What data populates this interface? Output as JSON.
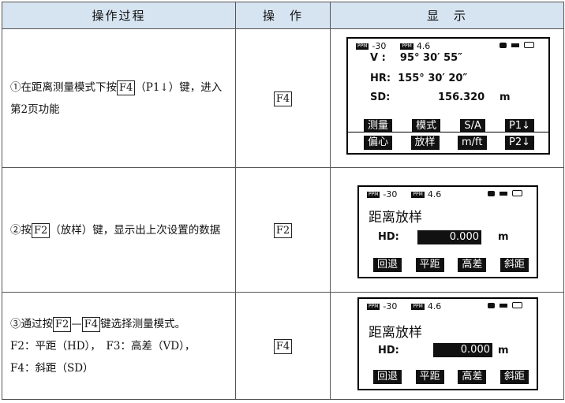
{
  "header": {
    "col1": "操作过程",
    "col2": "操　作",
    "col3": "显　示"
  },
  "rows": [
    {
      "desc_prefix": "①在距离测量模式下按",
      "desc_key": "F4",
      "desc_suffix": "（P1↓）键，进入第2页功能",
      "op_key": "F4",
      "screen": {
        "ppm_label": "PPM",
        "ppm_value": "-30",
        "prism_label": "PPM",
        "prism_value": "4.6",
        "lines": [
          {
            "label": "V  :",
            "value": "95° 30′ 55″",
            "unit": ""
          },
          {
            "label": "HR:",
            "value": "155° 30′ 20″",
            "unit": ""
          },
          {
            "label": "SD:",
            "value": "156.320",
            "unit": "m"
          }
        ],
        "softkeys_p1": [
          "测量",
          "模式",
          "S/A",
          "P1↓"
        ],
        "softkeys_p2": [
          "偏心",
          "放样",
          "m/ft",
          "P2↓"
        ]
      }
    },
    {
      "desc_prefix": "②按",
      "desc_key": "F2",
      "desc_suffix": "（放样）键，显示出上次设置的数据",
      "op_key": "F2",
      "screen": {
        "ppm_label": "PPM",
        "ppm_value": "-30",
        "prism_label": "PPM",
        "prism_value": "4.6",
        "title": "距离放样",
        "hd_label": "HD:",
        "hd_value": "0.000",
        "hd_unit": "m",
        "softkeys": [
          "回退",
          "平距",
          "高差",
          "斜距"
        ]
      }
    },
    {
      "desc_prefix": "③通过按",
      "desc_key": "F2",
      "desc_mid": "—",
      "desc_key2": "F4",
      "desc_suffix": "键选择测量模式。",
      "desc_line2": "F2：平距（HD），　F3：高差（VD），",
      "desc_line3": "F4：斜距（SD）",
      "op_key": "F4",
      "screen": {
        "ppm_label": "PPM",
        "ppm_value": "-30",
        "prism_label": "PPM",
        "prism_value": "4.6",
        "title": "距离放样",
        "hd_label": "HD:",
        "hd_value": "0.000",
        "hd_unit": "m",
        "softkeys": [
          "回退",
          "平距",
          "高差",
          "斜距"
        ]
      }
    }
  ]
}
